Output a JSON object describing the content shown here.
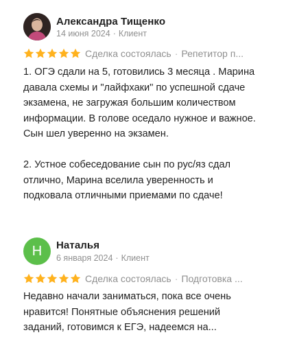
{
  "reviews": [
    {
      "author": "Александра Тищенко",
      "date": "14 июня 2024",
      "role": "Клиент",
      "rating": 5,
      "deal_status": "Сделка состоялась",
      "category": "Репетитор п...",
      "paragraphs": [
        "1. ОГЭ сдали на 5, готовились 3 месяца . Марина давала схемы и \"лайфхаки\" по успешной сдаче экзамена, не загружая большим количеством информации. В голове оседало нужное и важное. Сын шел уверенно на экзамен.",
        "2. Устное собеседование сын по рус/яз сдал отлично, Марина вселила уверенность и подковала отличными приемами по сдаче!"
      ]
    },
    {
      "author": "Наталья",
      "avatar_letter": "Н",
      "date": "6 января 2024",
      "role": "Клиент",
      "rating": 5,
      "deal_status": "Сделка состоялась",
      "category": "Подготовка ...",
      "paragraphs": [
        "Недавно начали заниматься, пока все очень нравится! Понятные объяснения решений заданий, готовимся к ЕГЭ, надеемся на..."
      ]
    }
  ],
  "colors": {
    "star": "#ffb21e",
    "avatar_green": "#5cbf4a",
    "meta_gray": "#8f8f8f",
    "text": "#1f1f1f"
  },
  "icons": {
    "star": "star-icon",
    "separator": "·"
  }
}
